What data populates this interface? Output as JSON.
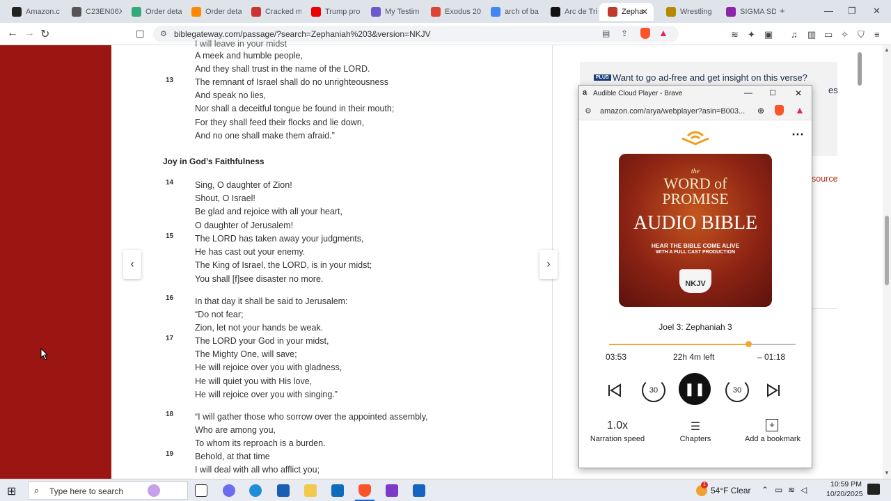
{
  "browser": {
    "tabs": [
      {
        "label": "Amazon.c",
        "fav": "a"
      },
      {
        "label": "C23EN06X",
        "fav": "c"
      },
      {
        "label": "Order deta",
        "fav": "o"
      },
      {
        "label": "Order deta",
        "fav": "g"
      },
      {
        "label": "Cracked m",
        "fav": "r"
      },
      {
        "label": "Trump pro",
        "fav": "y"
      },
      {
        "label": "My Testim",
        "fav": "m"
      },
      {
        "label": "Exodus 20",
        "fav": "e"
      },
      {
        "label": "arch of ba",
        "fav": "G"
      },
      {
        "label": "Arc de Tri",
        "fav": "d"
      },
      {
        "label": "Zepha",
        "fav": "z"
      },
      {
        "label": "Wrestling",
        "fav": "w"
      },
      {
        "label": "SIGMA SD",
        "fav": "s"
      }
    ],
    "new_tab": "+",
    "url": "biblegateway.com/passage/?search=Zephaniah%203&version=NKJV"
  },
  "passage": {
    "heading": "Joy in God’s Faithfulness",
    "top_partial": "I will leave in your midst",
    "verses": [
      {
        "num": "",
        "lines": [
          "A meek and humble people,",
          "And they shall trust in the name of the LORD."
        ]
      },
      {
        "num": "13",
        "lines": [
          "The remnant of Israel shall do no unrighteousness",
          "And speak no lies,",
          "Nor shall a deceitful tongue be found in their mouth;",
          "For they shall feed their flocks and lie down,",
          "And no one shall make them afraid.”"
        ]
      },
      {
        "num": "14",
        "lines": [
          "Sing, O daughter of Zion!",
          "Shout, O Israel!",
          "Be glad and rejoice with all your heart,",
          "O daughter of Jerusalem!"
        ]
      },
      {
        "num": "15",
        "lines": [
          "The LORD has taken away your judgments,",
          "He has cast out your enemy.",
          "The King of Israel, the LORD, is in your midst;",
          "You shall [f]see disaster no more."
        ]
      },
      {
        "num": "16",
        "lines": [
          "In that day it shall be said to Jerusalem:",
          "“Do not fear;",
          "Zion, let not your hands be weak."
        ]
      },
      {
        "num": "17",
        "lines": [
          "The LORD your God in your midst,",
          "The Mighty One, will save;",
          "He will rejoice over you with gladness,",
          "He will quiet you with His love,",
          "He will rejoice over you with singing.”"
        ]
      },
      {
        "num": "18",
        "lines": [
          "“I will gather those who sorrow over the appointed assembly,",
          "Who are among you,",
          "To whom its reproach is a burden."
        ]
      },
      {
        "num": "19",
        "lines": [
          "Behold, at that time",
          "I will deal with all who afflict you;"
        ]
      }
    ],
    "prev_arrow": "‹",
    "next_arrow": "›"
  },
  "sidebar": {
    "promo_badge": "PLUS",
    "promo_text": "Want to go ad-free and get insight on this verse?",
    "partial_es": "es",
    "partial_source": "source"
  },
  "player": {
    "window_title": "Audible Cloud Player - Brave",
    "url": "amazon.com/arya/webplayer?asin=B003...",
    "cover": {
      "the": "the",
      "word_of": "WORD of",
      "promise": "PROMISE",
      "audio_bible": "AUDIO BIBLE",
      "tag1": "HEAR THE BIBLE COME ALIVE",
      "tag2": "WITH A FULL CAST PRODUCTION",
      "badge": "NKJV"
    },
    "track_title": "Joel 3: Zephaniah 3",
    "elapsed": "03:53",
    "time_left": "22h 4m left",
    "remaining": "– 01:18",
    "progress_fraction": 0.745,
    "skip_back": "30",
    "skip_fwd": "30",
    "speed_value": "1.0x",
    "speed_label": "Narration speed",
    "chapters_label": "Chapters",
    "bookmark_label": "Add a bookmark"
  },
  "taskbar": {
    "search_placeholder": "Type here to search",
    "weather": "54°F  Clear",
    "time": "10:59 PM",
    "date": "10/20/2025",
    "notif_count": "1"
  }
}
